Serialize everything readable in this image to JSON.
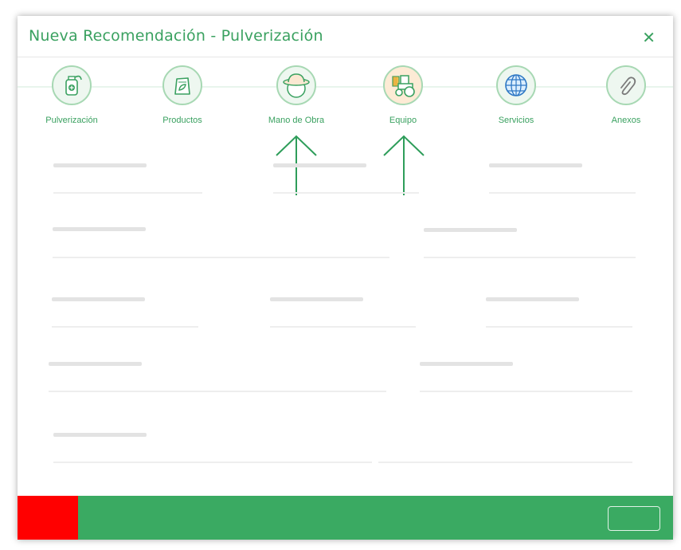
{
  "modal": {
    "title": "Nueva Recomendación - Pulverización",
    "close_symbol": "✕"
  },
  "steps": [
    {
      "label": "Pulverización",
      "icon": "sprayer-icon"
    },
    {
      "label": "Productos",
      "icon": "product-bag-icon"
    },
    {
      "label": "Mano de Obra",
      "icon": "farmer-hat-icon"
    },
    {
      "label": "Equipo",
      "icon": "tractor-icon"
    },
    {
      "label": "Servicios",
      "icon": "globe-icon"
    },
    {
      "label": "Anexos",
      "icon": "paperclip-icon"
    }
  ],
  "colors": {
    "brand_green": "#3aa160",
    "footer_green": "#3aaa62",
    "danger_red": "#ff0000",
    "active_step_bg": "#fdebd5",
    "arrow_green": "#2e9d5a"
  }
}
